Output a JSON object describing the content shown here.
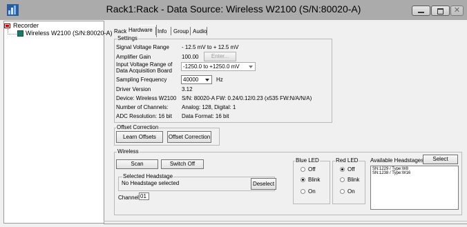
{
  "window": {
    "title": "Rack1:Rack - Data Source: Wireless W2100 (S/N:80020-A)",
    "close_glyph": "✕"
  },
  "tree": {
    "root_label": "Recorder",
    "child_label": "Wireless W2100 (S/N:80020-A)"
  },
  "tabs": [
    {
      "label": "Rack"
    },
    {
      "label": "Hardware",
      "active": true
    },
    {
      "label": "Info"
    },
    {
      "label": "Group"
    },
    {
      "label": "Audio"
    }
  ],
  "settings": {
    "title": "Settings",
    "signal_voltage_label": "Signal Voltage Range",
    "signal_voltage_value": "- 12.5 mV to + 12.5 mV",
    "amp_gain_label": "Amplifier Gain",
    "amp_gain_value": "100.00",
    "enter_button": "Enter...",
    "input_range_label_1": "Input Voltage Range of",
    "input_range_label_2": "Data Acquisition Board",
    "input_range_value": "-1250.0 to +1250.0 mV",
    "sampling_label": "Sampling Frequency",
    "sampling_value": "40000",
    "sampling_unit": "Hz",
    "driver_label": "Driver Version",
    "driver_value": "3.12",
    "device_label": "Device: Wireless W2100",
    "device_value": "S/N: 80020-A FW: 0.24/0.12/0.23 (x535 FW:N/A/N/A)",
    "channels_label": "Number of Channels:",
    "channels_value": "Analog: 128, Digital: 1",
    "adc_label": "ADC Resolution: 16 bit",
    "adc_value": "Data Format: 16 bit"
  },
  "offset": {
    "title": "Offset Correction",
    "learn_button": "Learn Offsets",
    "correction_button": "Offset Correction"
  },
  "wireless": {
    "title": "Wireless",
    "scan_button": "Scan",
    "switch_off_button": "Switch Off",
    "selected_headstage_title": "Selected Headstage",
    "selected_headstage_value": "No Headstage selected",
    "deselect_button": "Deselect",
    "channel_label": "Channel:",
    "channel_value": "01",
    "blue_led": {
      "title": "Blue LED",
      "options": [
        "Off",
        "Blink",
        "On"
      ],
      "selected": "Blink"
    },
    "red_led": {
      "title": "Red LED",
      "options": [
        "Off",
        "Blink",
        "On"
      ],
      "selected": "Off"
    },
    "available_label": "Available Headstages:",
    "select_button": "Select",
    "headstages": [
      "SN:1229 / Type:W8",
      "SN:1238 / Type:W16"
    ]
  }
}
